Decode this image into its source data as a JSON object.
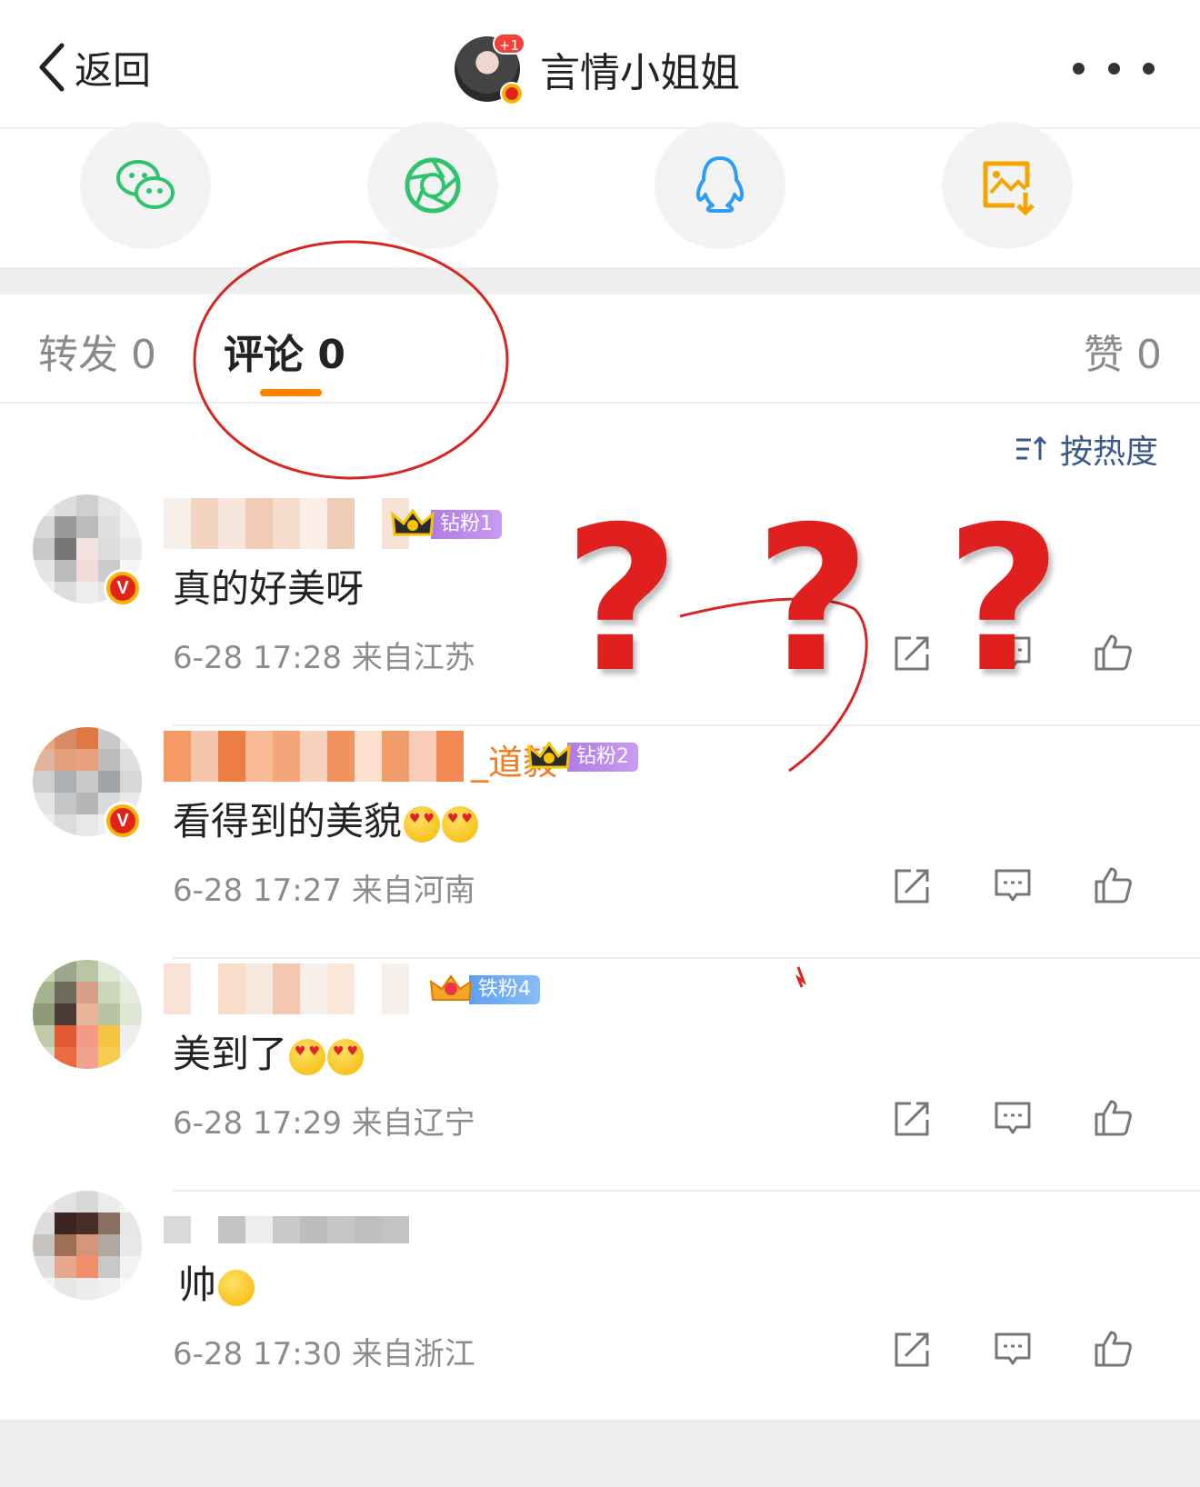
{
  "header": {
    "back_label": "返回",
    "title": "言情小姐姐",
    "avatar_badge": "+1"
  },
  "share": [
    "wechat-icon",
    "moments-icon",
    "qq-icon",
    "save-image-icon"
  ],
  "colors": {
    "accent": "#ff8200",
    "fan_purple": "#b07be8",
    "fan_blue": "#5fa0f5",
    "verified": "#e2231a",
    "annotation": "#e0201e"
  },
  "tabs": [
    {
      "label": "转发 0"
    },
    {
      "label": "评论 0"
    },
    {
      "label": "赞 0"
    }
  ],
  "sort": {
    "label": "按热度"
  },
  "comments": [
    {
      "name_tail": "",
      "fan_label": "钻粉1",
      "text": "真的好美呀",
      "time": "6-28 17:28 来自江苏"
    },
    {
      "name_tail": "_道毅",
      "fan_label": "钻粉2",
      "text": "看得到的美貌",
      "time": "6-28 17:27 来自河南"
    },
    {
      "name_tail": "",
      "fan_label": "铁粉4",
      "text": "美到了",
      "time": "6-28 17:29 来自辽宁"
    },
    {
      "name_tail": "",
      "fan_label": "",
      "text": "帅",
      "time": "6-28 17:30 来自浙江"
    }
  ],
  "annotation": {
    "marks": [
      "?",
      "?",
      "?"
    ]
  }
}
